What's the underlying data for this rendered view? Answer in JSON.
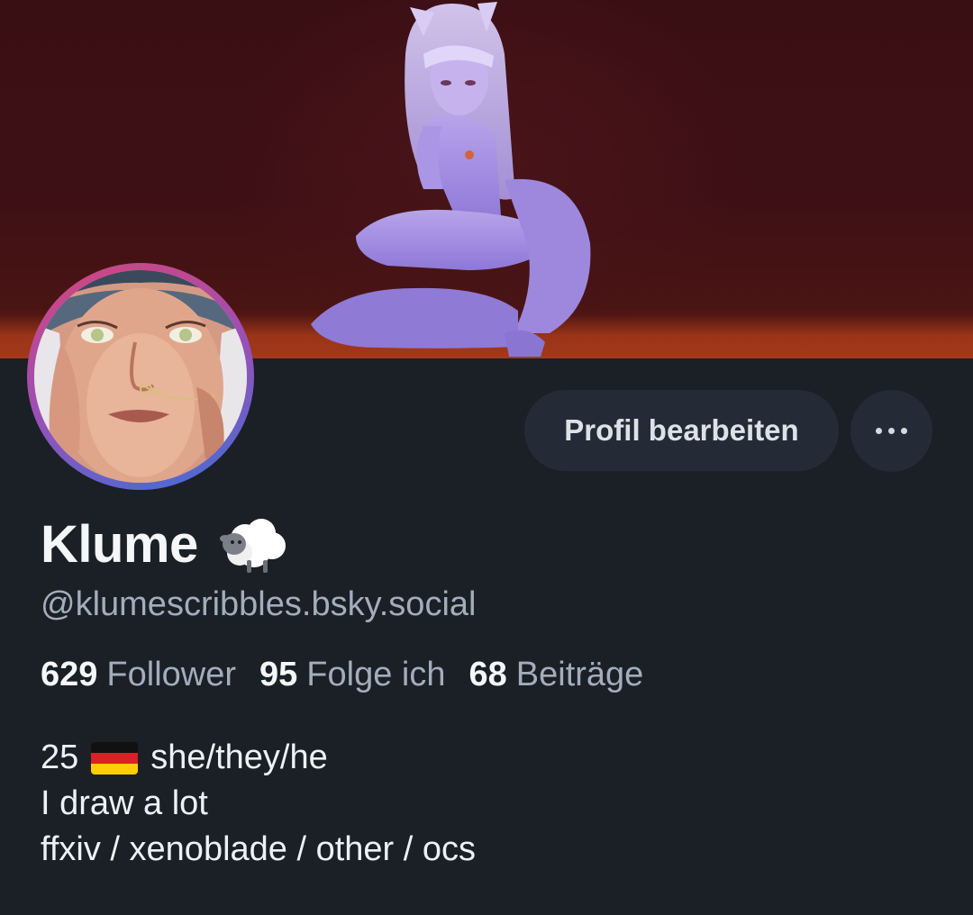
{
  "profile": {
    "display_name": "Klume",
    "name_emoji": "sheep-emoji",
    "handle": "@klumescribbles.bsky.social",
    "edit_button_label": "Profil bearbeiten",
    "more_icon": "more-dots-icon"
  },
  "stats": {
    "followers_count": "629",
    "followers_label": "Follower",
    "following_count": "95",
    "following_label": "Folge ich",
    "posts_count": "68",
    "posts_label": "Beiträge"
  },
  "bio": {
    "line1_prefix": "25",
    "line1_flag": "germany-flag",
    "line1_suffix": "she/they/he",
    "line2": "I draw a lot",
    "line3": "ffxiv / xenoblade / other / ocs"
  },
  "colors": {
    "background": "#1b1f26",
    "button_bg": "#252b36",
    "muted_text": "#a3adbb",
    "avatar_ring_start": "#d6457a",
    "avatar_ring_end": "#3f6fd8"
  }
}
